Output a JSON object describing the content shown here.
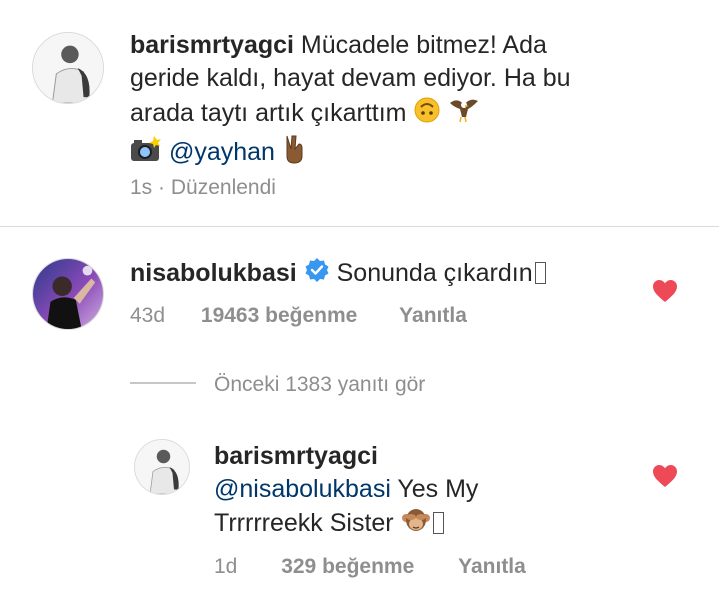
{
  "caption": {
    "username": "barismrtyagci",
    "text_line1": "Mücadele bitmez! Ada",
    "text_line2": "geride kaldı, hayat devam ediyor. Ha bu",
    "text_line3": "arada taytı artık çıkarttım",
    "emoji_line3": [
      "upside-down-face-emoji",
      "eagle-emoji"
    ],
    "camera_emoji": "camera-with-flash-emoji",
    "mention": "@yayhan",
    "victory_emoji": "victory-hand-emoji",
    "time": "1s",
    "separator": "·",
    "edited": "Düzenlendi"
  },
  "comment1": {
    "username": "nisabolukbasi",
    "verified": true,
    "text": "Sonunda çıkardın",
    "time": "43d",
    "likes": "19463 beğenme",
    "reply": "Yanıtla",
    "liked": true
  },
  "view_replies": "Önceki 1383 yanıtı gör",
  "reply1": {
    "username": "barismrtyagci",
    "mention": "@nisabolukbasi",
    "text_part1": "Yes My",
    "text_line2": "Trrrrreekk Sister",
    "emoji": "see-no-evil-monkey-emoji",
    "time": "1d",
    "likes": "329 beğenme",
    "reply": "Yanıtla",
    "liked": true
  },
  "colors": {
    "heart": "#ed4956",
    "verified": "#3897f0",
    "mention": "#00376b",
    "meta": "#8e8e8e"
  }
}
